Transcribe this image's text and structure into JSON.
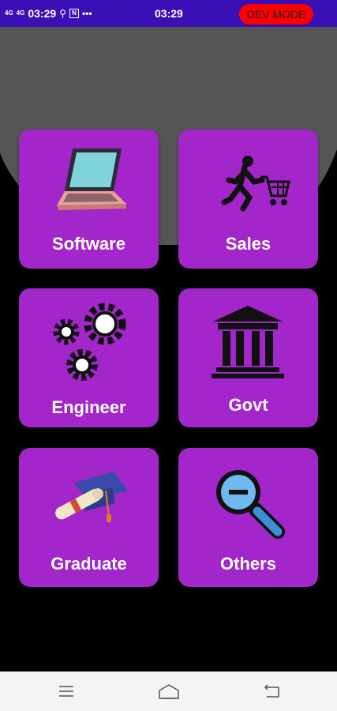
{
  "status_bar": {
    "signal_1": "4G",
    "signal_2": "4G",
    "time_left": "03:29",
    "time_center": "03:29",
    "overflow": "•••",
    "dev_mode_label": "DEV MODE"
  },
  "categories": [
    {
      "label": "Software",
      "icon": "laptop-icon"
    },
    {
      "label": "Sales",
      "icon": "shopping-cart-icon"
    },
    {
      "label": "Engineer",
      "icon": "gears-icon"
    },
    {
      "label": "Govt",
      "icon": "government-building-icon"
    },
    {
      "label": "Graduate",
      "icon": "graduation-cap-icon"
    },
    {
      "label": "Others",
      "icon": "magnifier-icon"
    }
  ],
  "nav": {
    "menu_icon": "menu-icon",
    "home_icon": "home-icon",
    "back_icon": "back-icon"
  },
  "colors": {
    "status_bar": "#3a0fb5",
    "tile": "#a226c9",
    "header": "#555555",
    "background": "#000000",
    "dev_badge": "#ff0000"
  }
}
